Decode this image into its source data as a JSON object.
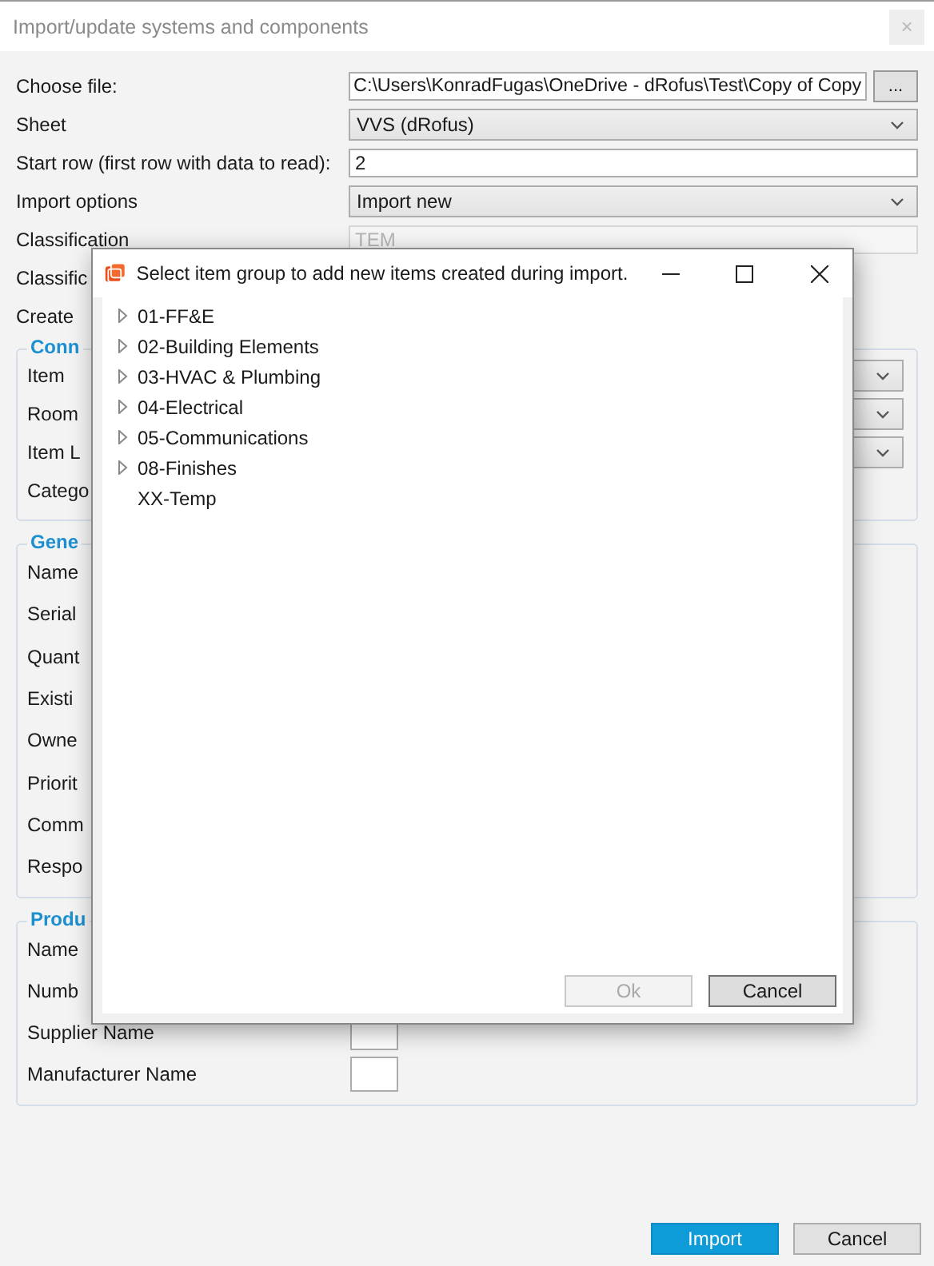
{
  "window": {
    "title": "Import/update systems and components",
    "close": "×"
  },
  "form": [
    {
      "label": "Choose file:",
      "kind": "file",
      "value": "C:\\Users\\KonradFugas\\OneDrive - dRofus\\Test\\Copy of Copy",
      "browse": "..."
    },
    {
      "label": "Sheet",
      "kind": "dropdown",
      "value": "VVS (dRofus)"
    },
    {
      "label": "Start row (first row with data to read):",
      "kind": "text",
      "value": "2",
      "disabled": false
    },
    {
      "label": "Import options",
      "kind": "dropdown",
      "value": "Import new"
    },
    {
      "label": "Classification",
      "kind": "text",
      "value": "TEM",
      "disabled": true
    },
    {
      "label": "Classific",
      "kind": "none"
    },
    {
      "label": "Create",
      "kind": "none"
    }
  ],
  "groups": [
    {
      "legend": "Conn",
      "rows": [
        {
          "label": "Item",
          "kind": "dropdown"
        },
        {
          "label": "Room",
          "kind": "dropdown"
        },
        {
          "label": "Item L",
          "kind": "dropdown"
        },
        {
          "label": "Catego",
          "kind": "none"
        }
      ]
    },
    {
      "legend": "Gene",
      "rows": [
        {
          "label": "Name",
          "kind": "none"
        },
        {
          "label": "Serial",
          "kind": "none"
        },
        {
          "label": "Quant",
          "kind": "none"
        },
        {
          "label": "Existi",
          "kind": "none"
        },
        {
          "label": "Owne",
          "kind": "none"
        },
        {
          "label": "Priorit",
          "kind": "none"
        },
        {
          "label": "Comm",
          "kind": "none"
        },
        {
          "label": "Respo",
          "kind": "none"
        }
      ]
    },
    {
      "legend": "Produ",
      "rows": [
        {
          "label": "Name",
          "kind": "none"
        },
        {
          "label": "Numb",
          "kind": "none"
        },
        {
          "label": "Supplier Name",
          "kind": "small-field"
        },
        {
          "label": "Manufacturer Name",
          "kind": "small-field"
        }
      ]
    }
  ],
  "buttons": [
    {
      "label": "Import",
      "kind": "primary"
    },
    {
      "label": "Cancel",
      "kind": "secondary"
    }
  ],
  "dialog": {
    "title": "Select item group to add new items created during import.",
    "tree": [
      {
        "label": "01-FF&E",
        "expandable": true
      },
      {
        "label": "02-Building Elements",
        "expandable": true
      },
      {
        "label": "03-HVAC & Plumbing",
        "expandable": true
      },
      {
        "label": "04-Electrical",
        "expandable": true
      },
      {
        "label": "05-Communications",
        "expandable": true
      },
      {
        "label": "08-Finishes",
        "expandable": true
      },
      {
        "label": "XX-Temp",
        "expandable": false
      }
    ],
    "buttons": [
      {
        "label": "Ok",
        "disabled": true
      },
      {
        "label": "Cancel",
        "disabled": false
      }
    ]
  }
}
